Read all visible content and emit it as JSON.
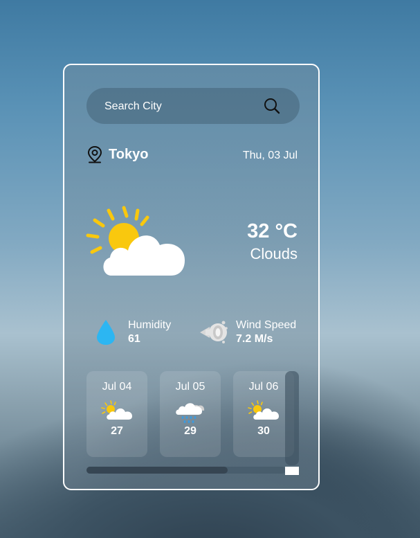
{
  "search": {
    "placeholder": "Search City",
    "icon": "search-icon"
  },
  "location": {
    "icon": "location-pin-icon",
    "city": "Tokyo",
    "date": "Thu, 03 Jul"
  },
  "current": {
    "icon": "sun-behind-cloud-icon",
    "temperature": "32 °C",
    "condition": "Clouds"
  },
  "details": {
    "humidity": {
      "icon": "water-drop-icon",
      "label": "Humidity",
      "value": "61"
    },
    "wind": {
      "icon": "wind-icon",
      "label": "Wind Speed",
      "value": "7.2 M/s"
    }
  },
  "forecast": [
    {
      "date": "Jul 04",
      "icon": "sun-behind-cloud-icon",
      "temp": "27"
    },
    {
      "date": "Jul 05",
      "icon": "rain-cloud-icon",
      "temp": "29"
    },
    {
      "date": "Jul 06",
      "icon": "sun-behind-cloud-icon",
      "temp": "30"
    }
  ],
  "colors": {
    "sun": "#F9C80E",
    "drop": "#2CB6F2",
    "rain": "#3A9BE0",
    "text": "#FFFFFF"
  }
}
